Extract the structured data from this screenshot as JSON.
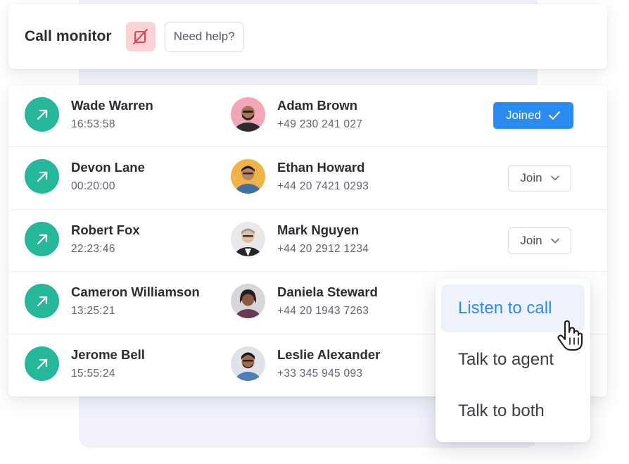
{
  "header": {
    "title": "Call monitor",
    "mute_icon": "muted-camera-icon",
    "help_label": "Need help?"
  },
  "colors": {
    "accent": "#2a8cf0",
    "call_icon_bg": "#25b79a",
    "mute_bg": "#fbd3d6",
    "mute_stroke": "#e0454f"
  },
  "calls": [
    {
      "agent": "Wade Warren",
      "duration": "16:53:58",
      "caller": "Adam Brown",
      "phone": "+49 230 241 027",
      "action": "Joined",
      "joined": true
    },
    {
      "agent": "Devon Lane",
      "duration": "00:20:00",
      "caller": "Ethan Howard",
      "phone": "+44 20 7421 0293",
      "action": "Join",
      "joined": false
    },
    {
      "agent": "Robert Fox",
      "duration": "22:23:46",
      "caller": "Mark Nguyen",
      "phone": "+44 20 2912 1234",
      "action": "Join",
      "joined": false
    },
    {
      "agent": "Cameron Williamson",
      "duration": "13:25:21",
      "caller": "Daniela Steward",
      "phone": "+44 20 1943 7263",
      "action": "",
      "joined": false
    },
    {
      "agent": "Jerome Bell",
      "duration": "15:55:24",
      "caller": "Leslie Alexander",
      "phone": "+33 345 945 093",
      "action": "",
      "joined": false
    }
  ],
  "dropdown": {
    "items": [
      {
        "label": "Listen to call",
        "active": true
      },
      {
        "label": "Talk to agent",
        "active": false
      },
      {
        "label": "Talk to both",
        "active": false
      }
    ]
  }
}
